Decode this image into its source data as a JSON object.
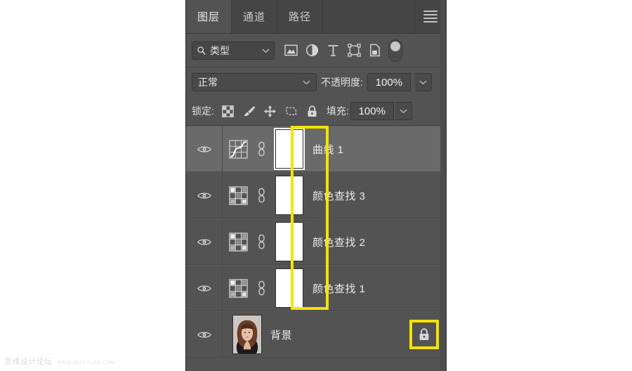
{
  "watermark": {
    "cn": "思缘设计论坛",
    "en": "WWW.MISSYUAN.COM"
  },
  "panel": {
    "title": "图层",
    "tabs": [
      {
        "label": "图层",
        "active": true
      },
      {
        "label": "通道",
        "active": false
      },
      {
        "label": "路径",
        "active": false
      }
    ],
    "menu_icon": "hamburger-menu-icon",
    "filter_row": {
      "search_icon": "search-icon",
      "kind_label": "类型",
      "caret_icon": "chevron-down-icon",
      "filter_icons": [
        "image-layer-filter-icon",
        "adjustment-layer-filter-icon",
        "type-layer-filter-icon",
        "shape-layer-filter-icon",
        "smart-object-filter-icon"
      ],
      "toggle_icon": "filter-enable-toggle"
    },
    "blend_row": {
      "blend_mode": "正常",
      "blend_caret_icon": "chevron-down-icon",
      "opacity_label": "不透明度:",
      "opacity_value": "100%",
      "opacity_caret_icon": "chevron-down-icon"
    },
    "lock_row": {
      "lock_label": "锁定:",
      "lock_icons": [
        "lock-transparent-pixels-icon",
        "lock-image-pixels-icon",
        "lock-position-icon",
        "lock-artboard-nesting-icon",
        "lock-all-icon"
      ],
      "fill_label": "填充:",
      "fill_value": "100%",
      "fill_caret_icon": "chevron-down-icon"
    },
    "layers": [
      {
        "name": "曲线 1",
        "visible": true,
        "selected": true,
        "adjustment_icon": "curves-adjustment-icon",
        "link_icon": "mask-link-icon",
        "mask_thumbnail": "white-layer-mask",
        "mask_selected": true,
        "locked": false
      },
      {
        "name": "颜色查找 3",
        "visible": true,
        "selected": false,
        "adjustment_icon": "color-lookup-adjustment-icon",
        "link_icon": "mask-link-icon",
        "mask_thumbnail": "white-layer-mask",
        "mask_selected": false,
        "locked": false
      },
      {
        "name": "颜色查找 2",
        "visible": true,
        "selected": false,
        "adjustment_icon": "color-lookup-adjustment-icon",
        "link_icon": "mask-link-icon",
        "mask_thumbnail": "white-layer-mask",
        "mask_selected": false,
        "locked": false
      },
      {
        "name": "颜色查找 1",
        "visible": true,
        "selected": false,
        "adjustment_icon": "color-lookup-adjustment-icon",
        "link_icon": "mask-link-icon",
        "mask_thumbnail": "white-layer-mask",
        "mask_selected": false,
        "locked": false
      },
      {
        "name": "背景",
        "visible": true,
        "selected": false,
        "thumbnail": "portrait-photo-thumbnail",
        "locked": true,
        "lock_icon": "lock-icon"
      }
    ],
    "annotations": {
      "mask_highlight_color": "#f5e303",
      "lock_highlight_color": "#f5e303"
    },
    "colors": {
      "panel_bg": "#535353",
      "tabbar_bg": "#454545",
      "selected_row_bg": "#6a6a6a",
      "text": "#eaeaea",
      "highlight": "#f5e303"
    }
  }
}
